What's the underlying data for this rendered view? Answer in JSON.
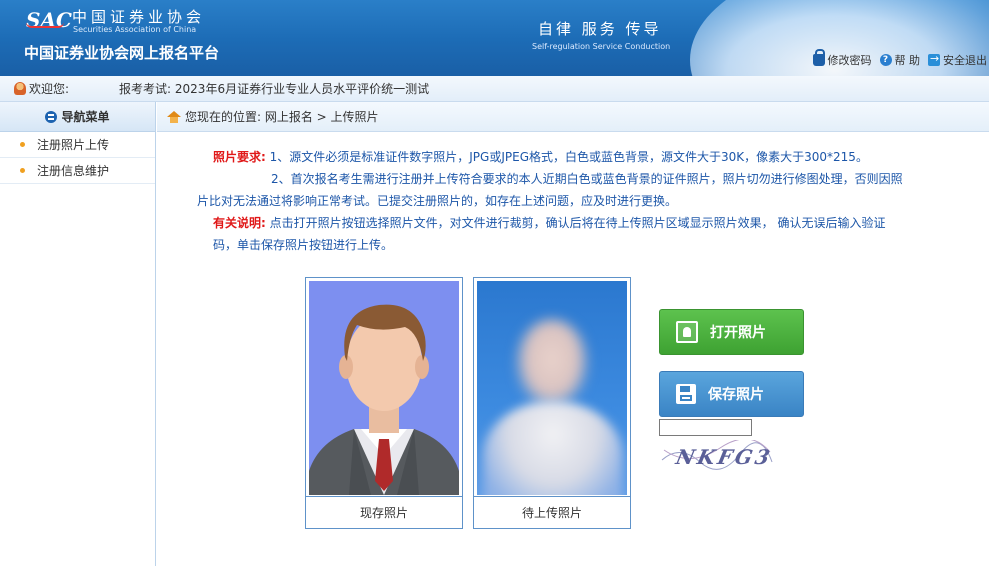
{
  "header": {
    "logo_abbr": "SAC",
    "org_name_cn": "中国证券业协会",
    "org_name_en": "Securities Association of China",
    "platform_title": "中国证券业协会网上报名平台",
    "motto_cn": "自律  服务  传导",
    "motto_en": "Self-regulation   Service   Conduction",
    "tools": {
      "change_password": "修改密码",
      "help": "帮 助",
      "logout": "安全退出"
    },
    "brand_color": "#1c6bb5"
  },
  "welcome_bar": {
    "greeting": "欢迎您:",
    "exam_text": "报考考试: 2023年6月证券行业专业人员水平评价统一测试"
  },
  "sidebar": {
    "title": "导航菜单",
    "items": [
      {
        "label": "注册照片上传"
      },
      {
        "label": "注册信息维护"
      }
    ]
  },
  "breadcrumb": {
    "text": "您现在的位置: 网上报名 > 上传照片"
  },
  "instructions": {
    "req_label": "照片要求:",
    "req_line1": " 1、源文件必须是标准证件数字照片，JPG或JPEG格式，白色或蓝色背景，源文件大于30K，像素大于300*215。",
    "req_line2a": "2、首次报名考生需进行注册并上传符合要求的本人近期白色或蓝色背景的证件照片，照片切勿进行修图处理，否则因照",
    "req_line2b": "片比对无法通过将影响正常考试。已提交注册照片的，如存在上述问题，应及时进行更换。",
    "note_label": "有关说明:",
    "note_line1": " 点击打开照片按钮选择照片文件，对文件进行裁剪，确认后将在待上传照片区域显示照片效果， 确认无误后输入验证",
    "note_line2": "码，单击保存照片按钮进行上传。"
  },
  "photos": {
    "current_caption": "现存照片",
    "pending_caption": "待上传照片"
  },
  "buttons": {
    "open_photo": "打开照片",
    "save_photo": "保存照片"
  },
  "captcha": {
    "value": "",
    "text": "NKFG3"
  }
}
